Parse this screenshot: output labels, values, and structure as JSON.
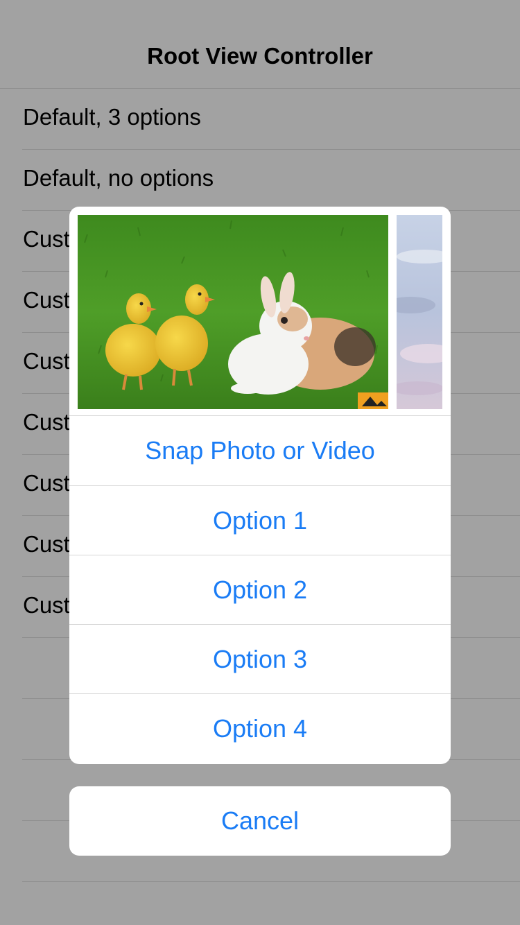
{
  "navbar": {
    "title": "Root View Controller"
  },
  "table": {
    "rows": [
      {
        "label": "Default, 3 options"
      },
      {
        "label": "Default, no options"
      },
      {
        "label": "Cust"
      },
      {
        "label": "Cust"
      },
      {
        "label": "Cust"
      },
      {
        "label": "Cust"
      },
      {
        "label": "Cust"
      },
      {
        "label": "Cust"
      },
      {
        "label": "Cust"
      },
      {
        "label": ""
      },
      {
        "label": ""
      },
      {
        "label": ""
      },
      {
        "label": ""
      }
    ]
  },
  "action_sheet": {
    "photos": [
      {
        "subject": "ducklings and rabbit on grass"
      },
      {
        "subject": "cloudy sky"
      }
    ],
    "actions": [
      {
        "label": "Snap Photo or Video"
      },
      {
        "label": "Option 1"
      },
      {
        "label": "Option 2"
      },
      {
        "label": "Option 3"
      },
      {
        "label": "Option 4"
      }
    ],
    "cancel_label": "Cancel"
  },
  "colors": {
    "accent": "#1a7cf5",
    "dim_background": "#a2a2a2",
    "sheet_background": "#ffffff",
    "separator": "#d6d6d6"
  }
}
